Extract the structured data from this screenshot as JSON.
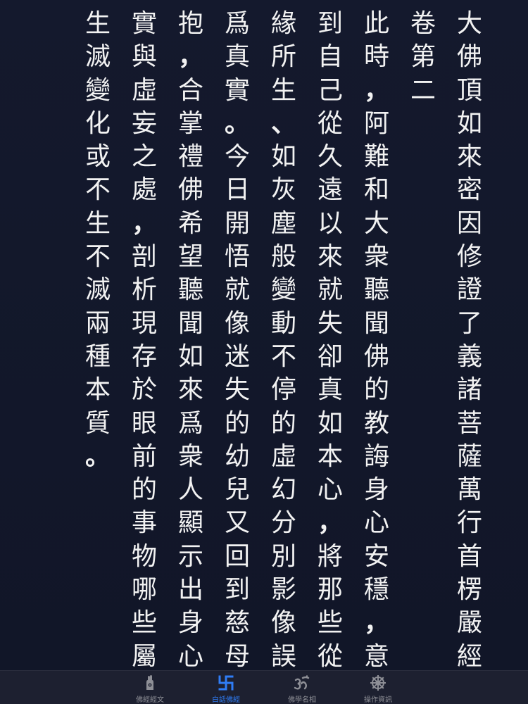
{
  "page_number": "1",
  "book": {
    "columns": [
      "大佛頂如來密因修證了義諸菩薩萬行首楞嚴經",
      "卷第二",
      "此時，阿難和大衆聽聞佛的教誨身心安穩，意識",
      "到自己從久遠以來就失卻真如本心，將那些從因",
      "緣所生、如灰塵般變動不停的虛幻分別影像誤認",
      "爲真實。今日開悟就像迷失的幼兒又回到慈母懷",
      "抱，合掌禮佛希望聽聞如來爲衆人顯示出身心真",
      "實與虛妄之處，剖析現存於眼前的事物哪些屬於",
      "生滅變化或不生不滅兩種本質。"
    ]
  },
  "tabbar": {
    "tabs": [
      {
        "name": "tab-sutra-text",
        "label": "佛經經文",
        "icon": "hand-icon",
        "active": false
      },
      {
        "name": "tab-vernacular",
        "label": "白話佛經",
        "icon": "swastika-icon",
        "active": true
      },
      {
        "name": "tab-glossary",
        "label": "佛學名相",
        "icon": "om-icon",
        "active": false
      },
      {
        "name": "tab-info",
        "label": "操作資訊",
        "icon": "dharma-wheel-icon",
        "active": false
      }
    ],
    "active_color": "#2f7df6",
    "inactive_color": "#8e8f96"
  }
}
